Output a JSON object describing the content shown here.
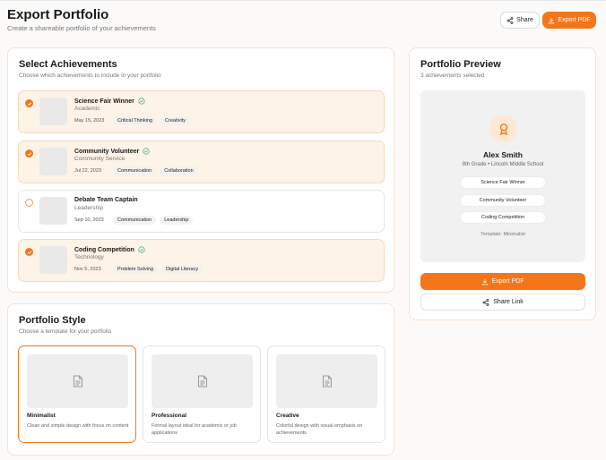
{
  "header": {
    "title": "Export Portfolio",
    "subtitle": "Create a shareable portfolio of your achievements",
    "share_label": "Share",
    "export_label": "Export PDF"
  },
  "achievements": {
    "title": "Select Achievements",
    "subtitle": "Choose which achievements to include in your portfolio",
    "items": [
      {
        "title": "Science Fair Winner",
        "category": "Academic",
        "date": "May 15, 2023",
        "tags": [
          "Critical Thinking",
          "Creativity"
        ],
        "selected": true,
        "verified": true
      },
      {
        "title": "Community Volunteer",
        "category": "Community Service",
        "date": "Jul 22, 2023",
        "tags": [
          "Communication",
          "Collaboration"
        ],
        "selected": true,
        "verified": true
      },
      {
        "title": "Debate Team Captain",
        "category": "Leadership",
        "date": "Sep 10, 2023",
        "tags": [
          "Communication",
          "Leadership"
        ],
        "selected": false,
        "verified": false
      },
      {
        "title": "Coding Competition",
        "category": "Technology",
        "date": "Nov 5, 2023",
        "tags": [
          "Problem Solving",
          "Digital Literacy"
        ],
        "selected": true,
        "verified": true
      }
    ]
  },
  "style": {
    "title": "Portfolio Style",
    "subtitle": "Choose a template for your portfolio",
    "templates": [
      {
        "name": "Minimalist",
        "description": "Clean and simple design with focus on content",
        "active": true
      },
      {
        "name": "Professional",
        "description": "Formal layout ideal for academic or job applications",
        "active": false
      },
      {
        "name": "Creative",
        "description": "Colorful design with visual emphasis on achievements",
        "active": false
      }
    ]
  },
  "preview": {
    "title": "Portfolio Preview",
    "subtitle": "3 achievements selected",
    "name": "Alex Smith",
    "meta": "8th Grade • Lincoln Middle School",
    "pills": [
      "Science Fair Winner",
      "Community Volunteer",
      "Coding Competition"
    ],
    "template_label": "Template: Minimalist",
    "export_label": "Export PDF",
    "share_label": "Share Link"
  },
  "colors": {
    "accent": "#f5761a",
    "verified": "#3bb26e",
    "selected_bg": "#fdf3e7"
  }
}
